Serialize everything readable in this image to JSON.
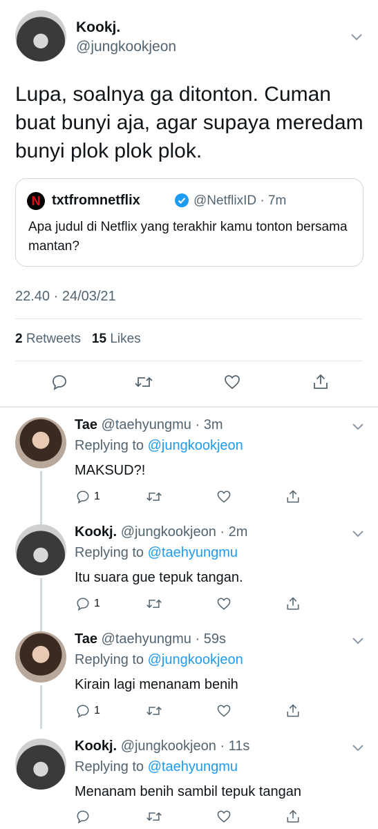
{
  "main_tweet": {
    "display_name": "Kookj.",
    "handle": "@jungkookjeon",
    "text": "Lupa, soalnya ga ditonton. Cuman buat bunyi aja, agar supaya meredam bunyi plok plok plok.",
    "quote": {
      "logo": "N",
      "display_name": "txtfromnetflix",
      "handle_time": "@NetflixID · 7m",
      "text": "Apa judul di Netflix yang terakhir kamu tonton bersama mantan?"
    },
    "timestamp": "22.40 · 24/03/21",
    "retweets_count": "2",
    "retweets_label": "Retweets",
    "likes_count": "15",
    "likes_label": "Likes"
  },
  "replies": [
    {
      "display_name": "Tae",
      "handle_time": "@taehyungmu · 3m",
      "replying_label": "Replying to",
      "replying_to": "@jungkookjeon",
      "text": "MAKSUD?!",
      "reply_count": "1"
    },
    {
      "display_name": "Kookj.",
      "handle_time": "@jungkookjeon · 2m",
      "replying_label": "Replying to",
      "replying_to": "@taehyungmu",
      "text": "Itu suara gue tepuk tangan.",
      "reply_count": "1"
    },
    {
      "display_name": "Tae",
      "handle_time": "@taehyungmu · 59s",
      "replying_label": "Replying to",
      "replying_to": "@jungkookjeon",
      "text": "Kirain lagi menanam benih",
      "reply_count": "1"
    },
    {
      "display_name": "Kookj.",
      "handle_time": "@jungkookjeon · 11s",
      "replying_label": "Replying to",
      "replying_to": "@taehyungmu",
      "text": "Menanam benih sambil tepuk tangan",
      "reply_count": ""
    }
  ],
  "icons": {
    "reply": "reply-icon",
    "retweet": "retweet-icon",
    "like": "heart-icon",
    "share": "share-icon",
    "more": "chevron-down-icon",
    "verified": "verified-badge-icon"
  },
  "colors": {
    "accent": "#1d9bf0",
    "secondary_text": "#536471",
    "netflix_red": "#e50914"
  }
}
